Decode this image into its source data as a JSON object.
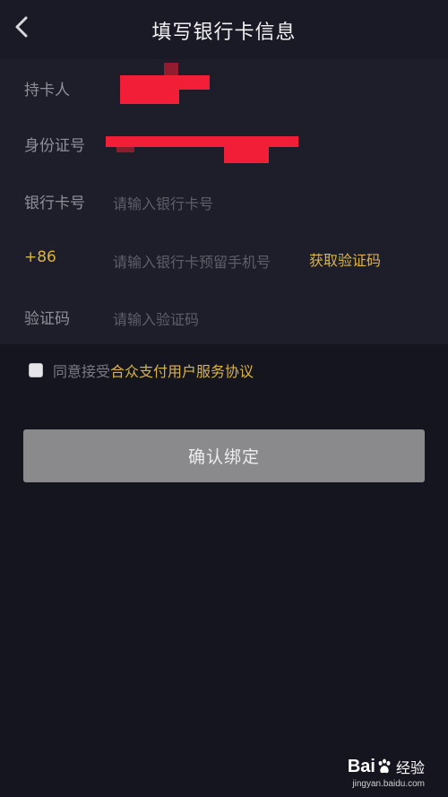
{
  "header": {
    "title": "填写银行卡信息",
    "back_icon": "chevron-left-icon"
  },
  "form": {
    "cardholder": {
      "label": "持卡人"
    },
    "id_number": {
      "label": "身份证号"
    },
    "card_number": {
      "label": "银行卡号",
      "placeholder": "请输入银行卡号"
    },
    "phone": {
      "prefix": "+86",
      "placeholder": "请输入银行卡预留手机号",
      "get_code_label": "获取验证码"
    },
    "verify_code": {
      "label": "验证码",
      "placeholder": "请输入验证码"
    }
  },
  "agreement": {
    "prefix": "同意接受",
    "link_text": "合众支付用户服务协议",
    "checked": false
  },
  "confirm_button": {
    "label": "确认绑定"
  },
  "watermark": {
    "logo_a": "Bai",
    "logo_b": "经验",
    "url": "jingyan.baidu.com"
  },
  "colors": {
    "background": "#15151f",
    "form_background": "#1e1e2a",
    "accent": "#d9b24a",
    "button": "#8a8a8c",
    "redaction": "#f21d36"
  }
}
